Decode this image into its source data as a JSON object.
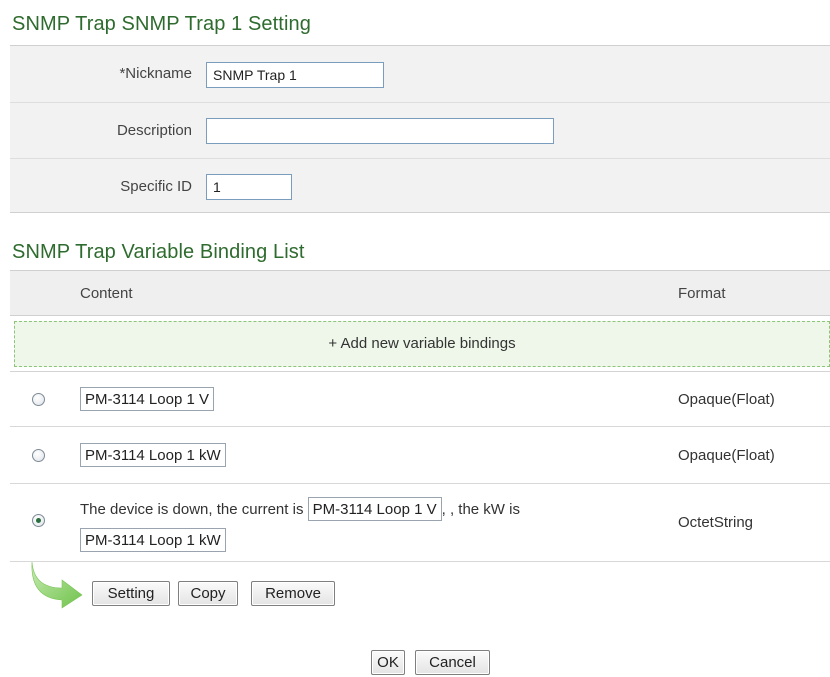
{
  "settings": {
    "title": "SNMP Trap SNMP Trap 1 Setting",
    "nickname_label": "*Nickname",
    "nickname_value": "SNMP Trap 1",
    "description_label": "Description",
    "description_value": "",
    "specific_id_label": "Specific ID",
    "specific_id_value": "1"
  },
  "binding_list": {
    "title": "SNMP Trap Variable Binding List",
    "headers": {
      "content": "Content",
      "format": "Format"
    },
    "add_label": "+ Add new variable bindings",
    "rows": [
      {
        "selected": false,
        "chip": "PM-3114 Loop 1 V",
        "format": "Opaque(Float)"
      },
      {
        "selected": false,
        "chip": "PM-3114 Loop 1 kW",
        "format": "Opaque(Float)"
      },
      {
        "selected": true,
        "text_before": "The device is down, the current is",
        "chip_1": "PM-3114 Loop 1 V",
        "text_middle": ", the kW is",
        "chip_2": "PM-3114 Loop 1 kW",
        "format": "OctetString"
      }
    ]
  },
  "row_actions": {
    "setting": "Setting",
    "copy": "Copy",
    "remove": "Remove"
  },
  "footer": {
    "ok": "OK",
    "cancel": "Cancel"
  },
  "colors": {
    "title_green": "#2e6b2e",
    "add_row_bg": "#eef7e9",
    "add_row_border": "#8cc57a",
    "arrow_green": "#8fd16e"
  }
}
